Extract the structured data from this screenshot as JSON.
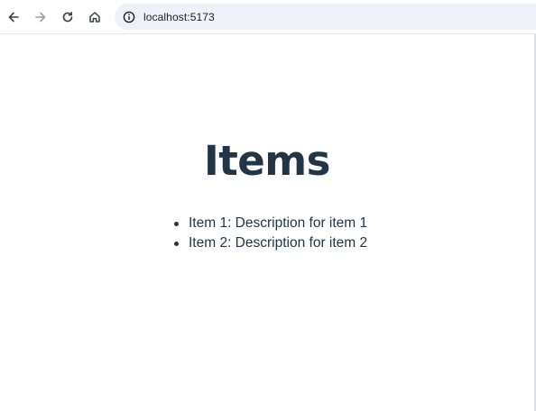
{
  "browser": {
    "url": "localhost:5173",
    "icons": [
      "back-arrow-icon",
      "forward-arrow-icon",
      "reload-icon",
      "home-icon",
      "info-icon"
    ]
  },
  "page": {
    "title": "Items",
    "items": [
      "Item 1: Description for item 1",
      "Item 2: Description for item 2"
    ]
  },
  "colors": {
    "text": "#213547",
    "address_bar_bg": "#eef1f7"
  }
}
